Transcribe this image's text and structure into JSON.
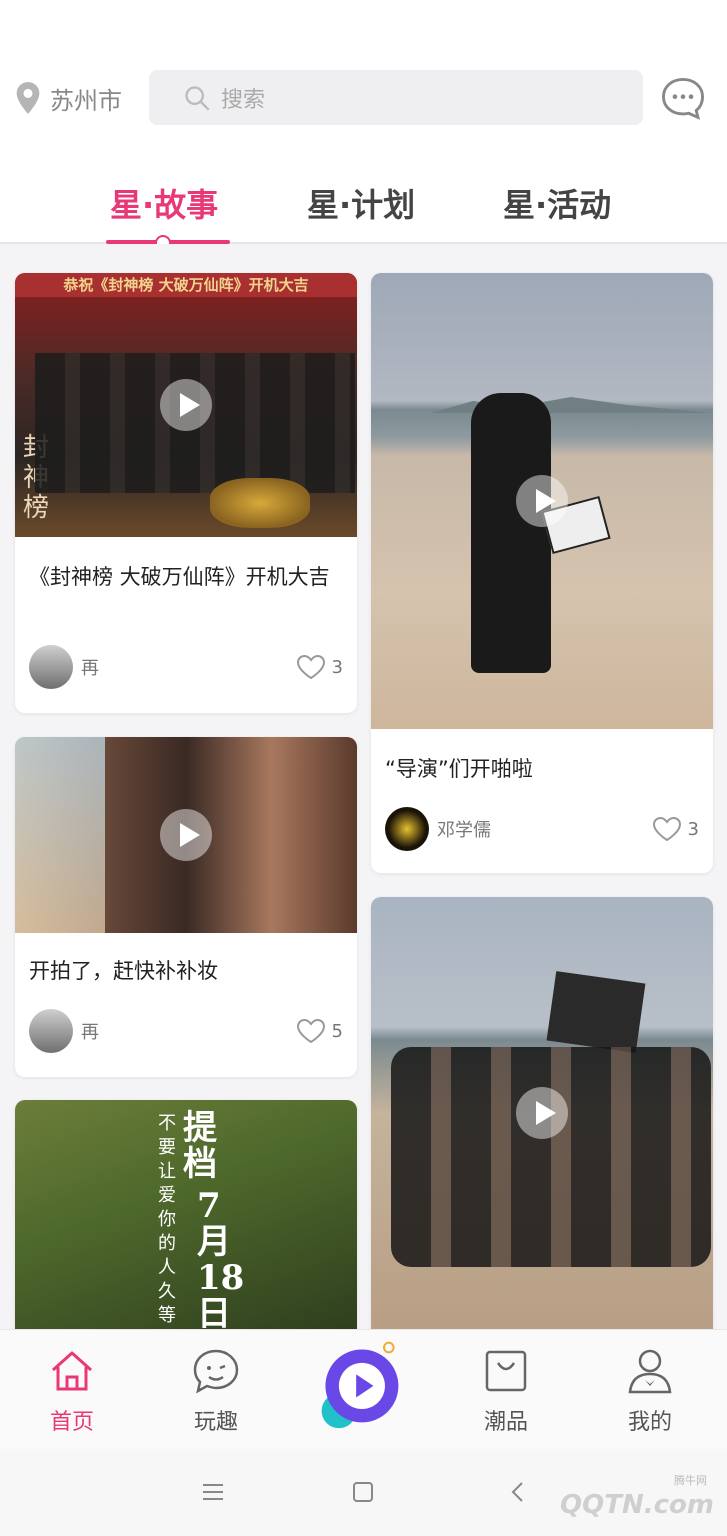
{
  "header": {
    "city": "苏州市",
    "search_placeholder": "搜索"
  },
  "tabs": [
    {
      "label": "星·故事",
      "active": true
    },
    {
      "label": "星·计划",
      "active": false
    },
    {
      "label": "星·活动",
      "active": false
    }
  ],
  "feed": {
    "left": [
      {
        "poster_banner": "恭祝《封神榜 大破万仙阵》开机大吉",
        "poster_vertical": "封神榜",
        "title": "《封神榜 大破万仙阵》开机大吉",
        "author": "再",
        "likes": "3"
      },
      {
        "title": "开拍了，赶快补补妆",
        "author": "再",
        "likes": "5"
      },
      {
        "poster_vertical_1": "提档",
        "poster_vertical_2": "7月18日",
        "poster_vertical_3": "不要让爱你的人久等"
      }
    ],
    "right": [
      {
        "title": "“导演”们开啪啦",
        "author": "邓学儒",
        "likes": "3"
      },
      {}
    ]
  },
  "bottom_nav": [
    {
      "label": "首页",
      "icon": "home-icon",
      "active": true
    },
    {
      "label": "玩趣",
      "icon": "chat-face-icon",
      "active": false
    },
    {
      "label": "",
      "icon": "play-center-icon",
      "active": false
    },
    {
      "label": "潮品",
      "icon": "bag-icon",
      "active": false
    },
    {
      "label": "我的",
      "icon": "profile-icon",
      "active": false
    }
  ],
  "watermark": {
    "main": "QQTN.com",
    "small": "腾牛网"
  },
  "colors": {
    "accent": "#e83878",
    "feed_bg": "#f4f4f6"
  }
}
